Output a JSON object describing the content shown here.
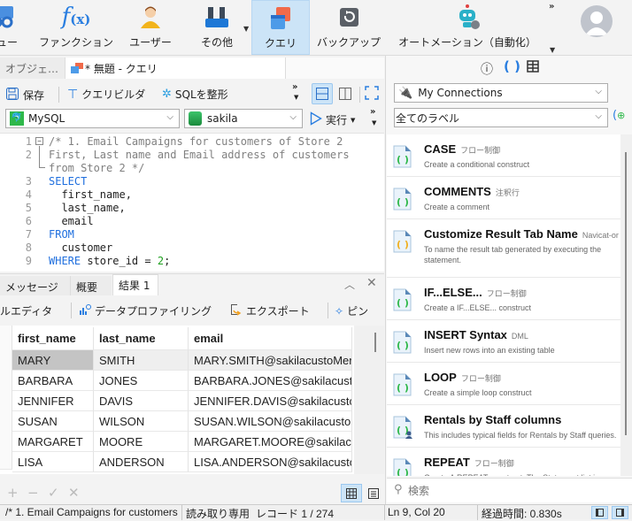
{
  "ribbon": {
    "items": [
      {
        "label": "ビュー",
        "icon": "view-icon"
      },
      {
        "label": "ファンクション",
        "icon": "function-icon"
      },
      {
        "label": "ユーザー",
        "icon": "user-icon"
      },
      {
        "label": "その他",
        "icon": "tools-icon"
      },
      {
        "label": "クエリ",
        "icon": "query-icon",
        "active": true
      },
      {
        "label": "バックアップ",
        "icon": "backup-icon"
      },
      {
        "label": "オートメーション（自動化）",
        "icon": "automation-robot-icon"
      }
    ],
    "overflow": "»"
  },
  "tabs": {
    "objects": "オブジェ…",
    "query": "* 無題 - クエリ"
  },
  "toolbar": {
    "save": "保存",
    "query_builder": "クエリビルダ",
    "format_sql": "SQLを整形",
    "overflow": "»",
    "run": "実行"
  },
  "connection": {
    "db_type": "MySQL",
    "database": "sakila"
  },
  "editor": {
    "lines": [
      {
        "n": "1",
        "text": "/* 1. Email Campaigns for customers of Store 2"
      },
      {
        "n": "2",
        "text": "First, Last name and Email address of customers"
      },
      {
        "n": "",
        "text": "from Store 2 */"
      },
      {
        "n": "3",
        "text": "SELECT"
      },
      {
        "n": "4",
        "text": "  first_name,"
      },
      {
        "n": "5",
        "text": "  last_name,"
      },
      {
        "n": "6",
        "text": "  email"
      },
      {
        "n": "7",
        "text": "FROM"
      },
      {
        "n": "8",
        "text": "  customer"
      },
      {
        "n": "9",
        "text": "WHERE store_id = 2;"
      }
    ]
  },
  "result_tabs": {
    "message": "メッセージ",
    "summary": "概要",
    "result1": "結果 1"
  },
  "result_toolbar": {
    "cell_editor": "ルエディタ",
    "profiling": "データプロファイリング",
    "export": "エクスポート",
    "pin": "ピン"
  },
  "grid": {
    "columns": [
      "first_name",
      "last_name",
      "email"
    ],
    "rows": [
      [
        "MARY",
        "SMITH",
        "MARY.SMITH@sakilacustoMer."
      ],
      [
        "BARBARA",
        "JONES",
        "BARBARA.JONES@sakilacustoM"
      ],
      [
        "JENNIFER",
        "DAVIS",
        "JENNIFER.DAVIS@sakilacustoM"
      ],
      [
        "SUSAN",
        "WILSON",
        "SUSAN.WILSON@sakilacustoM"
      ],
      [
        "MARGARET",
        "MOORE",
        "MARGARET.MOORE@sakilacus"
      ],
      [
        "LISA",
        "ANDERSON",
        "LISA.ANDERSON@sakilacustoM"
      ]
    ],
    "footer_buttons": [
      "+",
      "−",
      "✓",
      "✕"
    ]
  },
  "right_panel": {
    "connections": "My Connections",
    "labels": "全てのラベル",
    "search_placeholder": "検索",
    "snippets": [
      {
        "title": "CASE",
        "tag": "フロー制御",
        "desc": "Create a conditional construct",
        "color": "green"
      },
      {
        "title": "COMMENTS",
        "tag": "注釈行",
        "desc": "Create a comment",
        "color": "green"
      },
      {
        "title": "Customize Result Tab Name",
        "tag": "Navicat-or",
        "desc": "To name the result tab generated by executing the statement.",
        "color": "yellow"
      },
      {
        "title": "IF...ELSE...",
        "tag": "フロー制御",
        "desc": "Create a IF...ELSE... construct",
        "color": "green"
      },
      {
        "title": "INSERT Syntax",
        "tag": "DML",
        "desc": "Insert new rows into an existing table",
        "color": "green"
      },
      {
        "title": "LOOP",
        "tag": "フロー制御",
        "desc": "Create a simple loop construct",
        "color": "green"
      },
      {
        "title": "Rentals by Staff columns",
        "tag": "",
        "desc": "This includes typical fields for Rentals by Staff queries.",
        "color": "green-user"
      },
      {
        "title": "REPEAT",
        "tag": "フロー制御",
        "desc": "Create A REPEAT construct. The Statement list is",
        "color": "green"
      }
    ]
  },
  "status": {
    "query_name": "/* 1. Email Campaigns for customers",
    "readonly": "読み取り専用",
    "record": "レコード 1 / 274",
    "position": "Ln 9, Col 20",
    "elapsed": "経過時間: 0.830s"
  }
}
